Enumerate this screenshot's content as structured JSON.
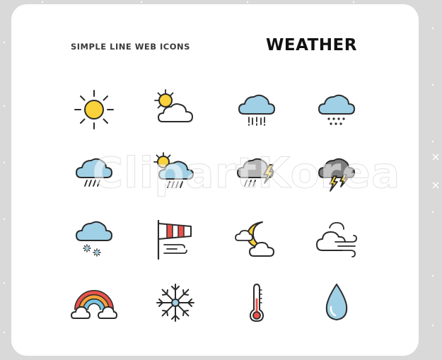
{
  "header": {
    "subtitle": "SIMPLE LINE WEB ICONS",
    "title": "WEATHER"
  },
  "watermark": {
    "text": "ClipartKorea"
  },
  "colors": {
    "background": "#d9d9d9",
    "card": "#ffffff",
    "stroke": "#2b2b2b",
    "sun": "#f9d13a",
    "cloud_blue": "#9fd0e6",
    "cloud_grey": "#b3b3b3",
    "cloud_dark": "#7d7d7d",
    "white": "#ffffff",
    "rainbow_red": "#e8524a",
    "rainbow_orange": "#f6a33a",
    "rainbow_blue": "#7cc3de",
    "thermo_red": "#e8524a",
    "drop_blue": "#9fd0e6"
  },
  "icons": [
    {
      "name": "sun-icon"
    },
    {
      "name": "sun-behind-cloud-icon"
    },
    {
      "name": "rain-cloud-icon"
    },
    {
      "name": "snow-cloud-icon"
    },
    {
      "name": "drizzle-cloud-icon"
    },
    {
      "name": "sun-cloud-rain-icon"
    },
    {
      "name": "thunderstorm-icon"
    },
    {
      "name": "heavy-thunderstorm-icon"
    },
    {
      "name": "snowflakes-cloud-icon"
    },
    {
      "name": "windsock-icon"
    },
    {
      "name": "moon-cloud-icon"
    },
    {
      "name": "windy-cloud-icon"
    },
    {
      "name": "rainbow-icon"
    },
    {
      "name": "snowflake-icon"
    },
    {
      "name": "thermometer-icon"
    },
    {
      "name": "water-drop-icon"
    }
  ]
}
